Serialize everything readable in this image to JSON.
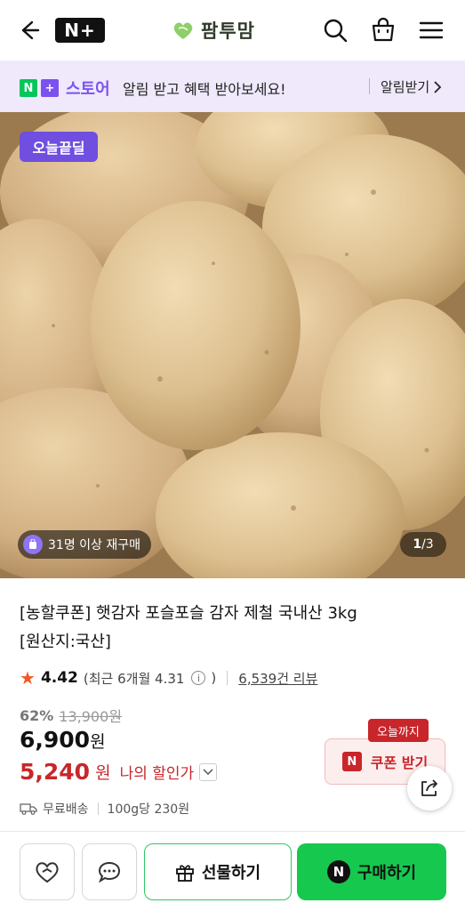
{
  "header": {
    "nplus_label": "N+",
    "logo_text": "팜투맘"
  },
  "banner": {
    "store_n": "N",
    "store_plus": "+",
    "store_text": "스토어",
    "message": "알림 받고 혜택 받아보세요!",
    "link": "알림받기"
  },
  "hero": {
    "badge": "오늘끝딜",
    "repurchase": "31명 이상 재구매",
    "page_current": "1",
    "page_total": "/3"
  },
  "product": {
    "title_line1": "[농할쿠폰] 햇감자 포슬포슬 감자 제철 국내산 3kg",
    "title_line2": "[원산지:국산]",
    "rating": "4.42",
    "rating_note": "(최근 6개월 4.31",
    "rating_note_end": ")",
    "reviews": "6,539건 리뷰",
    "discount_rate": "62%",
    "original_price": "13,900원",
    "price": "6,900",
    "price_unit": "원",
    "my_price": "5,240",
    "my_price_unit": "원",
    "my_price_label": "나의 할인가",
    "shipping": "무료배송",
    "unit_price": "100g당 230원"
  },
  "coupon": {
    "tag": "오늘까지",
    "n": "N",
    "label": "쿠폰 받기"
  },
  "actions": {
    "gift": "선물하기",
    "buy_n": "N",
    "buy": "구매하기"
  },
  "colors": {
    "naver_green": "#03c75a",
    "store_purple": "#7b52f0",
    "sale_red": "#c7272b",
    "buy_green": "#16c94e"
  }
}
